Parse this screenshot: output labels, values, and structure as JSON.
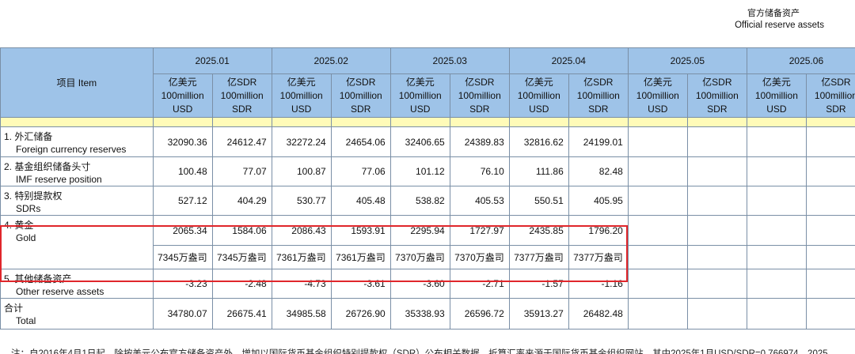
{
  "heading": {
    "title_zh": "官方储备资产",
    "title_en": "Official reserve assets"
  },
  "table": {
    "item_header": "项目 Item",
    "months": [
      "2025.01",
      "2025.02",
      "2025.03",
      "2025.04",
      "2025.05",
      "2025.06"
    ],
    "unit_usd": [
      "亿美元",
      "100million",
      "USD"
    ],
    "unit_sdr": [
      "亿SDR",
      "100million",
      "SDR"
    ],
    "rows": [
      {
        "label_zh": "1. 外汇储备",
        "label_en": "Foreign currency reserves",
        "values": [
          "32090.36",
          "24612.47",
          "32272.24",
          "24654.06",
          "32406.65",
          "24389.83",
          "32816.62",
          "24199.01",
          "",
          "",
          "",
          ""
        ]
      },
      {
        "label_zh": "2. 基金组织储备头寸",
        "label_en": "IMF reserve position",
        "values": [
          "100.48",
          "77.07",
          "100.87",
          "77.06",
          "101.12",
          "76.10",
          "111.86",
          "82.48",
          "",
          "",
          "",
          ""
        ]
      },
      {
        "label_zh": "3. 特别提款权",
        "label_en": "SDRs",
        "values": [
          "527.12",
          "404.29",
          "530.77",
          "405.48",
          "538.82",
          "405.53",
          "550.51",
          "405.95",
          "",
          "",
          "",
          ""
        ]
      },
      {
        "label_zh": "4. 黄金",
        "label_en": "Gold",
        "values": [
          "2065.34",
          "1584.06",
          "2086.43",
          "1593.91",
          "2295.94",
          "1727.97",
          "2435.85",
          "1796.20",
          "",
          "",
          "",
          ""
        ],
        "ounces": [
          "7345万盎司",
          "7345万盎司",
          "7361万盎司",
          "7361万盎司",
          "7370万盎司",
          "7370万盎司",
          "7377万盎司",
          "7377万盎司",
          "",
          "",
          "",
          ""
        ]
      },
      {
        "label_zh": "5. 其他储备资产",
        "label_en": "Other reserve assets",
        "values": [
          "-3.23",
          "-2.48",
          "-4.73",
          "-3.61",
          "-3.60",
          "-2.71",
          "-1.57",
          "-1.16",
          "",
          "",
          "",
          ""
        ]
      },
      {
        "label_zh": "合计",
        "label_en": "Total",
        "values": [
          "34780.07",
          "26675.41",
          "34985.58",
          "26726.90",
          "35338.93",
          "26596.72",
          "35913.27",
          "26482.48",
          "",
          "",
          "",
          ""
        ]
      }
    ]
  },
  "footnote": "注：自2016年4月1日起，除按美元公布官方储备资产外，增加以国际货币基金组织特别提款权（SDR）公布相关数据。折算汇率来源于国际货币基金组织网站。其中2025年1月USD/SDR=0.766974，2025",
  "colors": {
    "header_bg": "#9ec3e8",
    "spacer_bg": "#fffbb8",
    "highlight": "#e0262b"
  }
}
